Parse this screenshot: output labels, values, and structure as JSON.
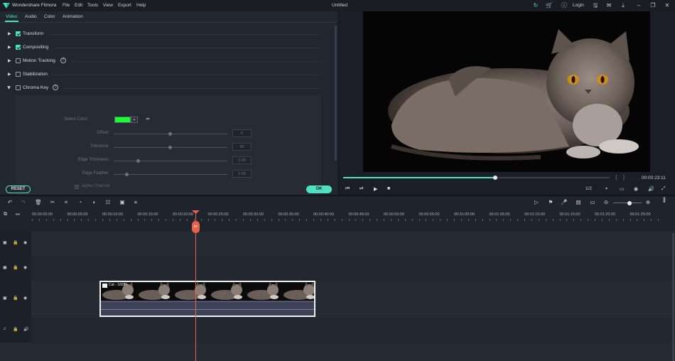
{
  "titlebar": {
    "app_name": "Wondershare Filmora",
    "menus": [
      "File",
      "Edit",
      "Tools",
      "View",
      "Export",
      "Help"
    ],
    "document_title": "Untitled",
    "login_label": "Login"
  },
  "left_panel": {
    "tabs": [
      "Video",
      "Audio",
      "Color",
      "Animation"
    ],
    "active_tab": "Video",
    "sections": [
      {
        "label": "Transform",
        "checked": true,
        "expanded": false
      },
      {
        "label": "Compositing",
        "checked": true,
        "expanded": false
      },
      {
        "label": "Motion Tracking",
        "checked": false,
        "expanded": false,
        "help": "?"
      },
      {
        "label": "Stabilization",
        "checked": false,
        "expanded": false
      },
      {
        "label": "Chroma Key",
        "checked": false,
        "expanded": true,
        "help": "?"
      }
    ],
    "chroma_key": {
      "select_color_label": "Select Color:",
      "select_color_value": "#19ff30",
      "rows": [
        {
          "label": "Offset:",
          "value": "0",
          "level": 0.5
        },
        {
          "label": "Tolerance:",
          "value": "50",
          "level": 0.5
        },
        {
          "label": "Edge Thickness:",
          "value": "2.00",
          "level": 0.22
        },
        {
          "label": "Edge Feather:",
          "value": "2.00",
          "level": 0.12
        }
      ],
      "alpha_channel_label": "Alpha Channel"
    },
    "reset_label": "RESET",
    "ok_label": "OK"
  },
  "preview": {
    "progress": 0.57,
    "timecode": "00:00:23:11",
    "ratio": "1/2"
  },
  "timeline": {
    "ruler_ticks": [
      "00:00:00:00",
      "00:00:05:00",
      "00:00:10:00",
      "00:00:15:00",
      "00:00:20:00",
      "00:00:25:00",
      "00:00:30:00",
      "00:00:35:00",
      "00:00:40:00",
      "00:00:45:00",
      "00:00:50:00",
      "00:00:55:00",
      "00:01:00:00",
      "00:01:05:00",
      "00:01:10:00",
      "00:01:15:00",
      "00:01:20:00",
      "00:01:25:00"
    ],
    "tracks": [
      {
        "id": "3",
        "kind": "video"
      },
      {
        "id": "2",
        "kind": "video"
      },
      {
        "id": "1",
        "kind": "video"
      },
      {
        "id": "1",
        "kind": "audio"
      }
    ],
    "clip": {
      "label": "Cat - 18284"
    }
  },
  "colors": {
    "accent": "#4fe0c0",
    "playhead": "#e8624a"
  }
}
